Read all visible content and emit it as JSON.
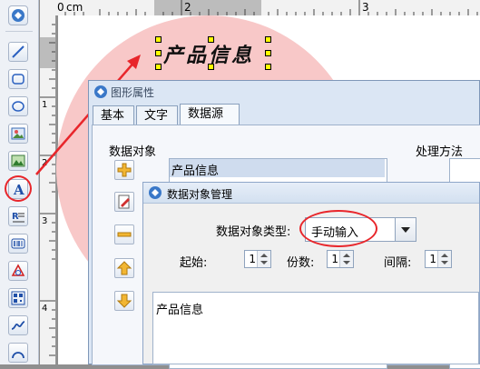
{
  "toolbar": {
    "items": [
      "app-menu",
      "line",
      "rounded-rect",
      "ellipse",
      "image",
      "picture",
      "text",
      "rich-text",
      "barcode",
      "logo",
      "qrcode",
      "curve",
      "arc"
    ]
  },
  "ruler": {
    "horizontal": {
      "origin": "0",
      "unit": "cm",
      "ticks": [
        "2",
        "3"
      ]
    },
    "vertical": {
      "ticks": [
        "1",
        "2",
        "3",
        "4"
      ]
    }
  },
  "canvas": {
    "label_text": "产品信息"
  },
  "dialog_properties": {
    "title": "图形属性",
    "tabs": [
      "基本",
      "文字",
      "数据源"
    ],
    "active_tab": "数据源",
    "data_objects_label": "数据对象",
    "data_objects": [
      "产品信息"
    ],
    "processing_label": "处理方法"
  },
  "dialog_manage": {
    "title": "数据对象管理",
    "type_label": "数据对象类型:",
    "type_value": "手动输入",
    "start_label": "起始:",
    "start_value": "1",
    "copies_label": "份数:",
    "copies_value": "1",
    "interval_label": "间隔:",
    "interval_value": "1",
    "content": "产品信息"
  },
  "colors": {
    "highlight": "#e8262b",
    "circle": "#f8c8c8",
    "selected_row": "#cfdcee"
  }
}
